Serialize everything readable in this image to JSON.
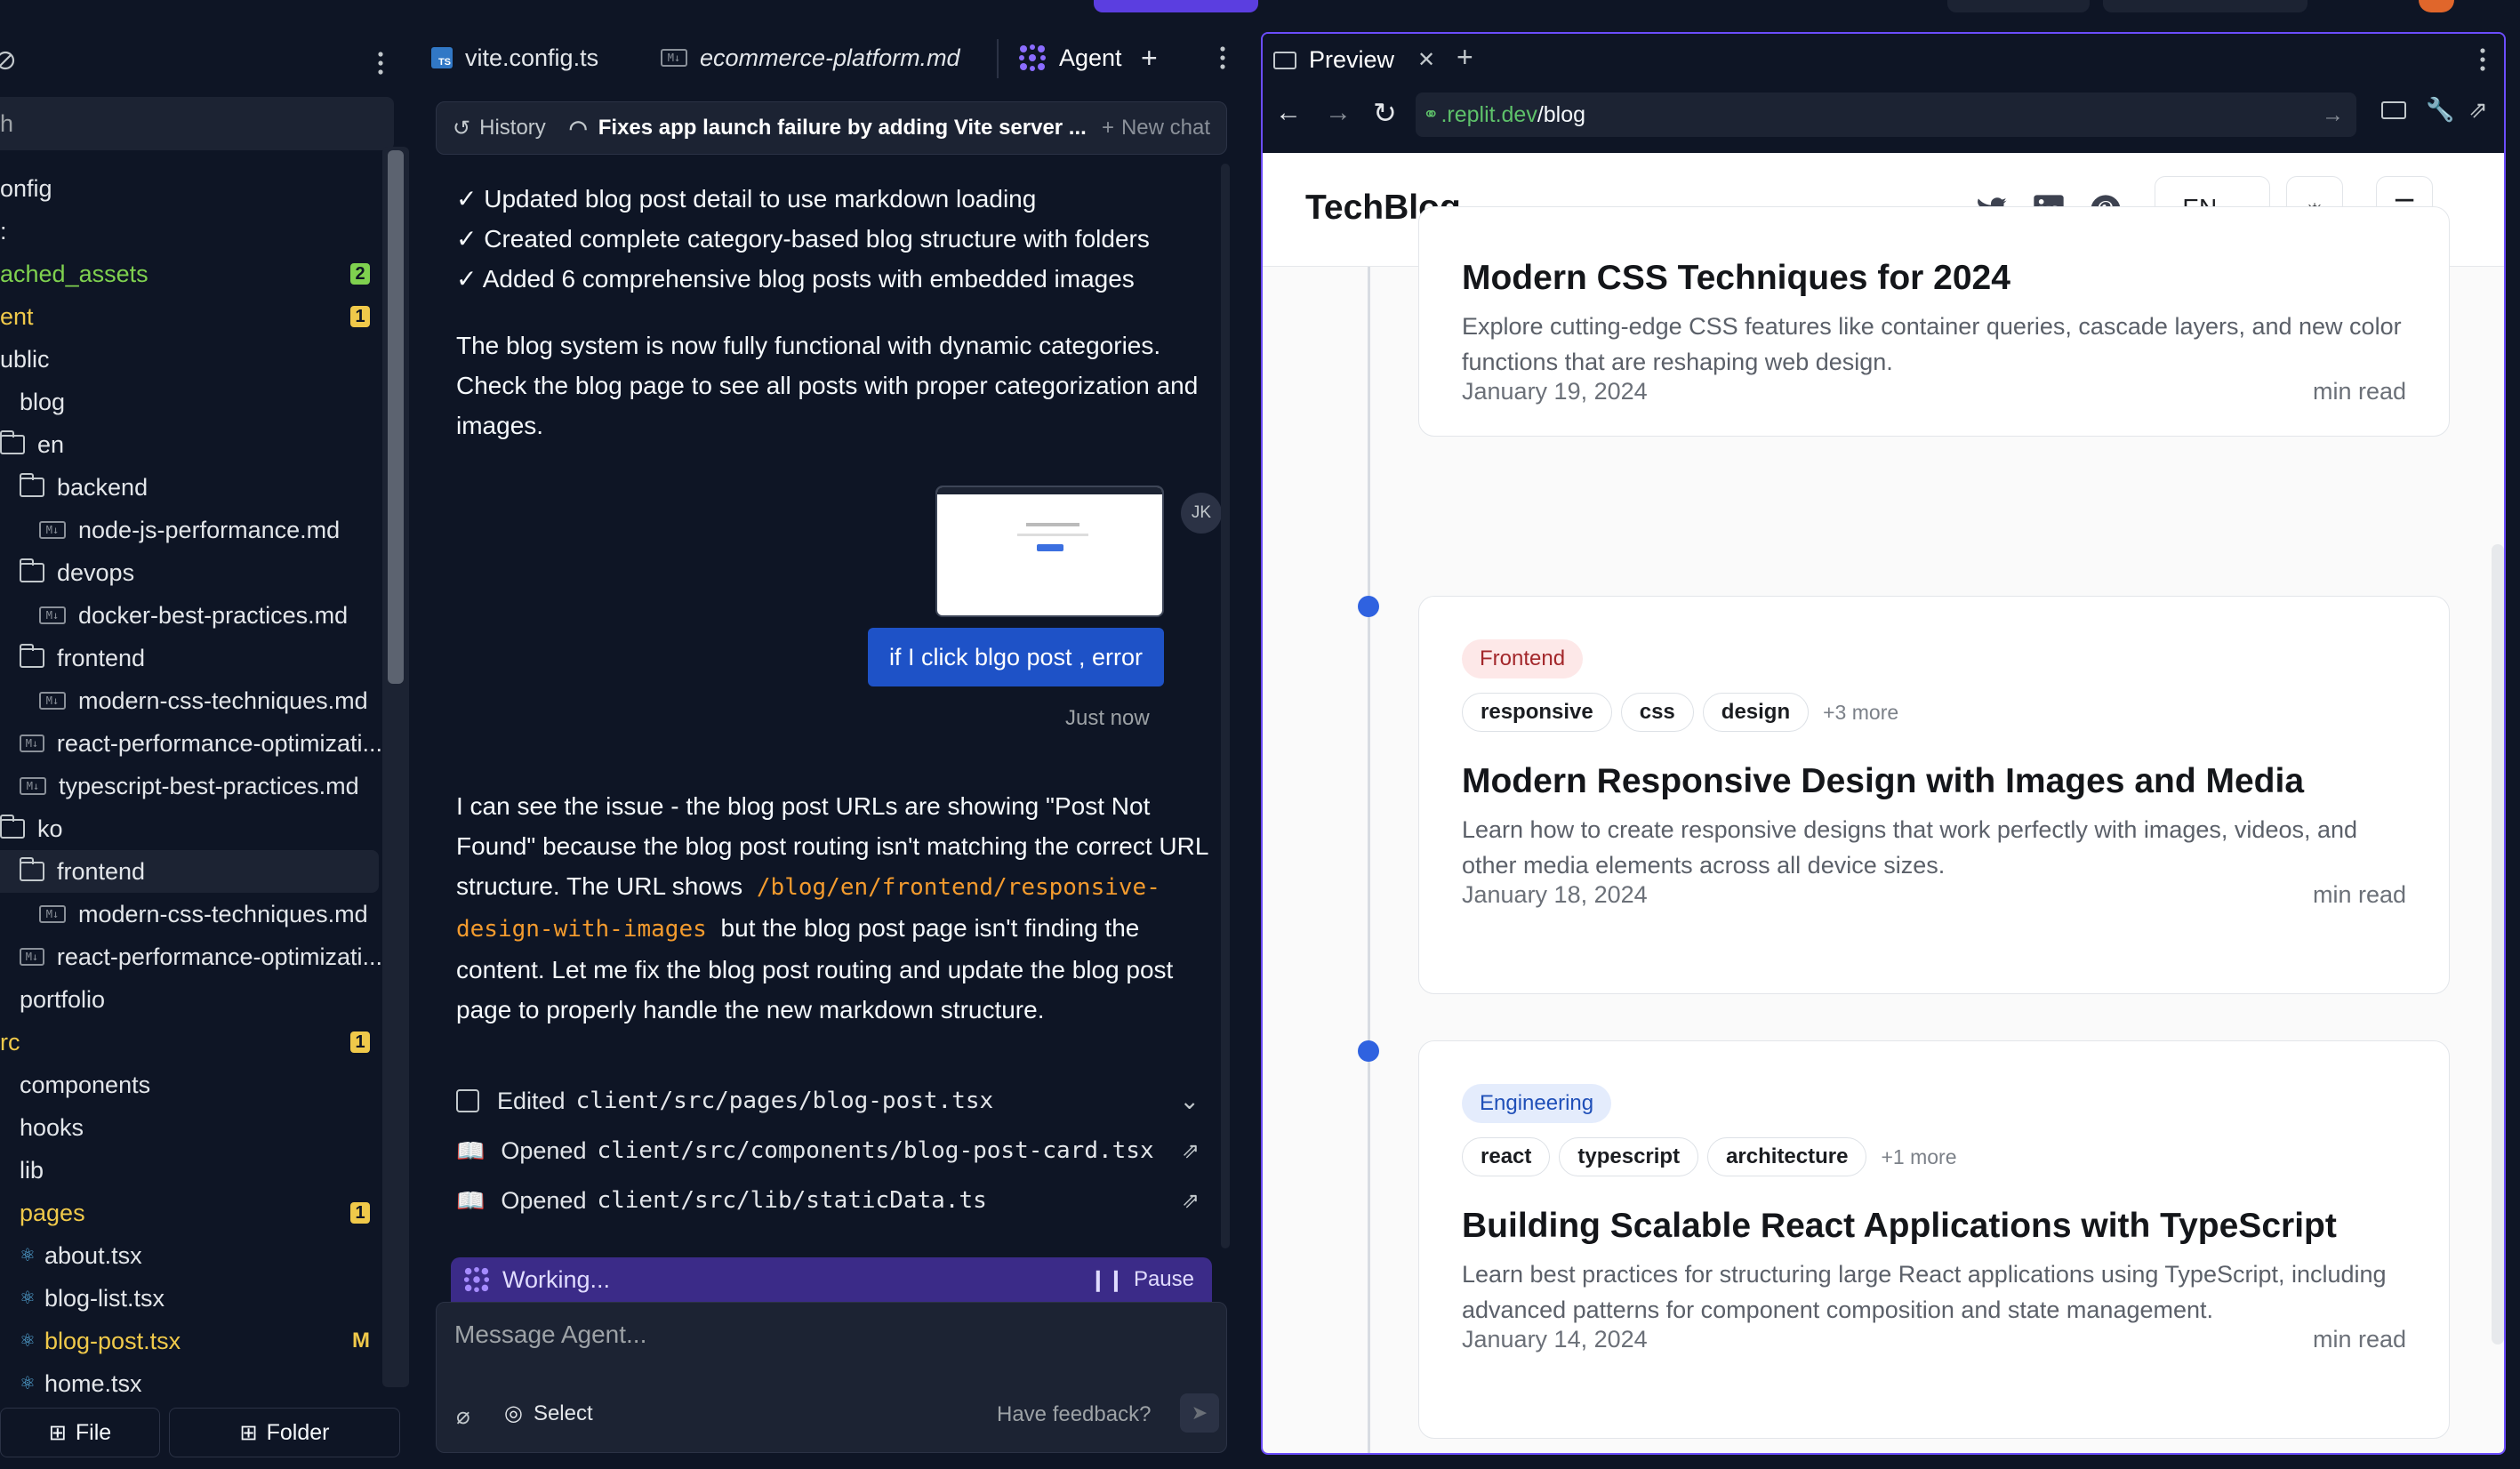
{
  "sidebar": {
    "search_placeholder": "h",
    "tree": [
      {
        "label": "onfig",
        "kind": "text",
        "indent": 0
      },
      {
        "label": ":",
        "kind": "text",
        "indent": 0
      },
      {
        "label": "ached_assets",
        "kind": "text",
        "indent": 0,
        "color": "#7fd14f",
        "badge": "2",
        "badge_color": "#7fd14f"
      },
      {
        "label": "ent",
        "kind": "text",
        "indent": 0,
        "color": "#f0c94a",
        "badge": "1",
        "badge_color": "#f0c94a"
      },
      {
        "label": "ublic",
        "kind": "text",
        "indent": 0
      },
      {
        "label": "blog",
        "kind": "text",
        "indent": 1
      },
      {
        "label": "en",
        "kind": "folder-open",
        "indent": 0
      },
      {
        "label": "backend",
        "kind": "folder",
        "indent": 1
      },
      {
        "label": "node-js-performance.md",
        "kind": "md",
        "indent": 2
      },
      {
        "label": "devops",
        "kind": "folder",
        "indent": 1
      },
      {
        "label": "docker-best-practices.md",
        "kind": "md",
        "indent": 2
      },
      {
        "label": "frontend",
        "kind": "folder",
        "indent": 1
      },
      {
        "label": "modern-css-techniques.md",
        "kind": "md",
        "indent": 2
      },
      {
        "label": "react-performance-optimizati...",
        "kind": "md",
        "indent": 1
      },
      {
        "label": "typescript-best-practices.md",
        "kind": "md",
        "indent": 1
      },
      {
        "label": "ko",
        "kind": "folder-open",
        "indent": 0
      },
      {
        "label": "frontend",
        "kind": "folder",
        "indent": 1,
        "selected": true
      },
      {
        "label": "modern-css-techniques.md",
        "kind": "md",
        "indent": 2
      },
      {
        "label": "react-performance-optimizati...",
        "kind": "md",
        "indent": 1
      },
      {
        "label": "portfolio",
        "kind": "text",
        "indent": 1
      },
      {
        "label": "rc",
        "kind": "text",
        "indent": 0,
        "color": "#f0c94a",
        "badge": "1",
        "badge_color": "#f0c94a"
      },
      {
        "label": "components",
        "kind": "text",
        "indent": 1
      },
      {
        "label": "hooks",
        "kind": "text",
        "indent": 1
      },
      {
        "label": "lib",
        "kind": "text",
        "indent": 1
      },
      {
        "label": "pages",
        "kind": "text",
        "indent": 1,
        "color": "#f0c94a",
        "badge": "1",
        "badge_color": "#f0c94a"
      },
      {
        "label": "about.tsx",
        "kind": "tsx",
        "indent": 1
      },
      {
        "label": "blog-list.tsx",
        "kind": "tsx",
        "indent": 1
      },
      {
        "label": "blog-post.tsx",
        "kind": "tsx",
        "indent": 1,
        "color": "#f0c94a",
        "mbadge": "M"
      },
      {
        "label": "home.tsx",
        "kind": "tsx",
        "indent": 1
      }
    ],
    "file_button": "File",
    "folder_button": "Folder"
  },
  "center": {
    "tabs": [
      {
        "label": "vite.config.ts"
      },
      {
        "label": "ecommerce-platform.md"
      },
      {
        "label": "Agent"
      }
    ],
    "history_label": "History",
    "chat_title": "Fixes app launch failure by adding Vite server ...",
    "new_chat_label": "New chat",
    "checklist": [
      "✓ Updated blog post detail to use markdown loading",
      "✓ Created complete category-based blog structure with folders",
      "✓ Added 6 comprehensive blog posts with embedded images"
    ],
    "summary": "The blog system is now fully functional with dynamic categories. Check the blog page to see all posts with proper categorization and images.",
    "user_avatar": "JK",
    "user_message": "if I click blgo post , error",
    "user_time": "Just now",
    "agent_reply_1": "I can see the issue - the blog post URLs are showing \"Post Not Found\" because the blog post routing isn't matching the correct URL structure. The URL shows",
    "agent_reply_code": "/blog/en/frontend/responsive-design-with-images",
    "agent_reply_2": "but the blog post page isn't finding the content. Let me fix the blog post routing and update the blog post page to properly handle the new markdown structure.",
    "actions": [
      {
        "verb": "Edited",
        "path": "client/src/pages/blog-post.tsx"
      },
      {
        "verb": "Opened",
        "path": "client/src/components/blog-post-card.tsx"
      },
      {
        "verb": "Opened",
        "path": "client/src/lib/staticData.ts"
      }
    ],
    "working_label": "Working...",
    "pause_label": "Pause",
    "message_placeholder": "Message Agent...",
    "select_label": "Select",
    "feedback_label": "Have feedback?"
  },
  "preview": {
    "tab_label": "Preview",
    "url_host": ".replit.dev",
    "url_path": "/blog",
    "site": {
      "logo": "TechBlog",
      "lang": "EN",
      "posts": [
        {
          "title": "Modern CSS Techniques for 2024",
          "desc": "Explore cutting-edge CSS features like container queries, cascade layers, and new color functions that are reshaping web design.",
          "date": "January 19, 2024",
          "read": "min read"
        },
        {
          "category": "Frontend",
          "tags": [
            "responsive",
            "css",
            "design"
          ],
          "more": "+3 more",
          "title": "Modern Responsive Design with Images and Media",
          "desc": "Learn how to create responsive designs that work perfectly with images, videos, and other media elements across all device sizes.",
          "date": "January 18, 2024",
          "read": "min read"
        },
        {
          "category": "Engineering",
          "tags": [
            "react",
            "typescript",
            "architecture"
          ],
          "more": "+1 more",
          "title": "Building Scalable React Applications with TypeScript",
          "desc": "Learn best practices for structuring large React applications using TypeScript, including advanced patterns for component composition and state management.",
          "date": "January 14, 2024",
          "read": "min read"
        }
      ]
    }
  }
}
